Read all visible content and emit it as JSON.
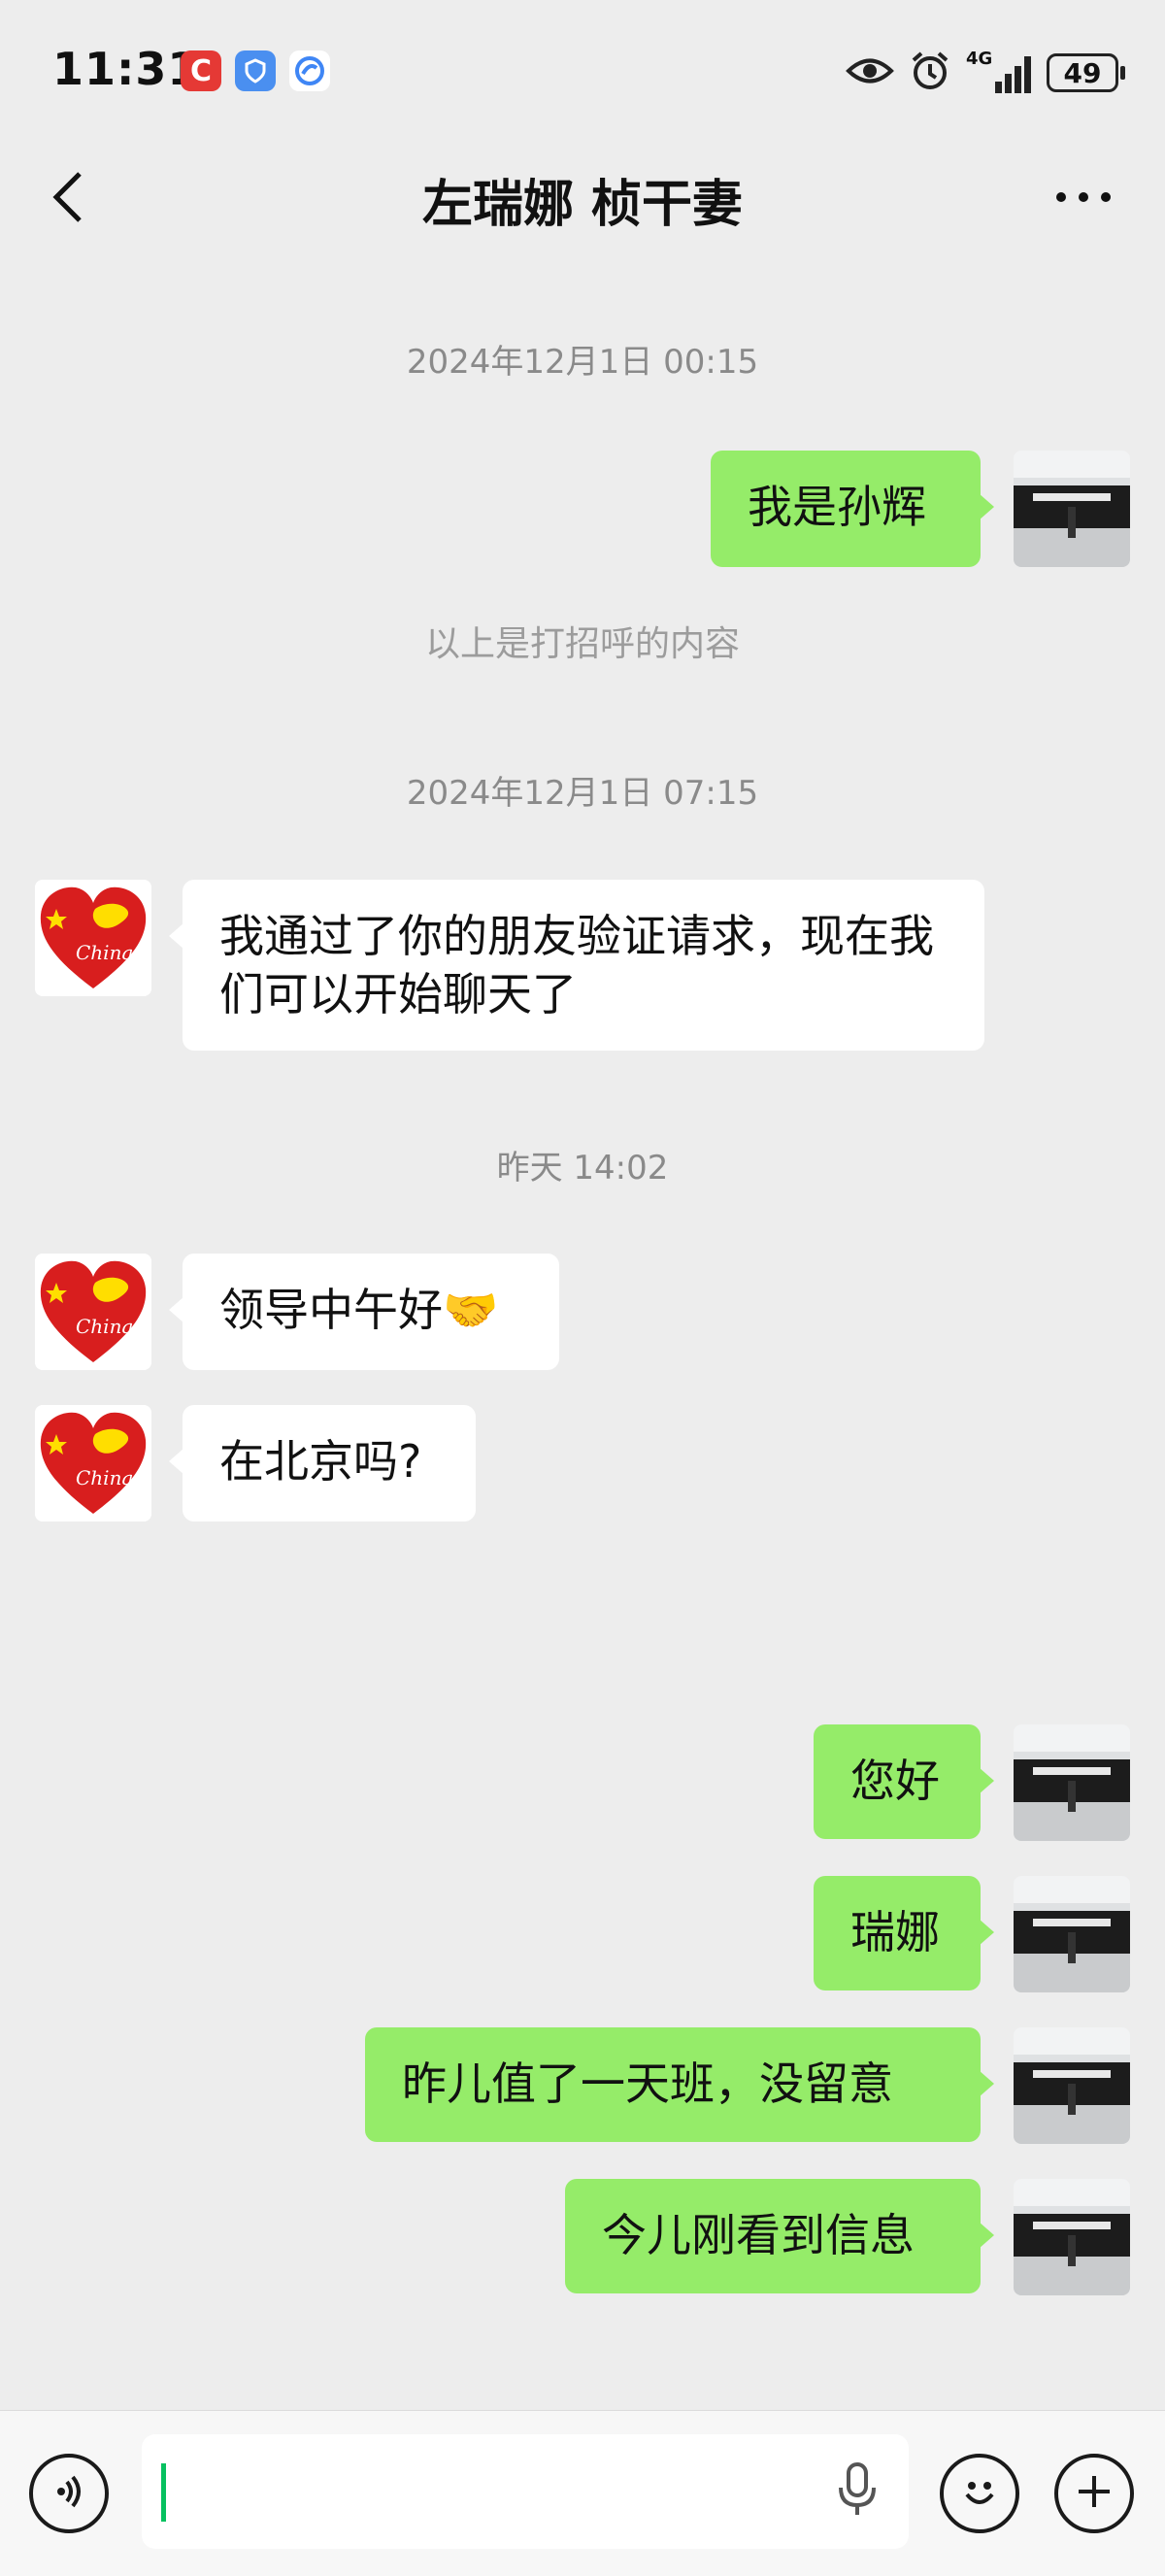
{
  "status_bar": {
    "time": "11:31",
    "network": "4G",
    "battery": "49",
    "icons": [
      "app-c-icon",
      "shield-app-icon",
      "sync-app-icon",
      "eye-icon",
      "alarm-icon",
      "signal-icon",
      "battery-icon"
    ]
  },
  "header": {
    "title": "左瑞娜 桢干妻",
    "back_icon": "chevron-left-icon",
    "more_icon": "more-icon"
  },
  "chat": {
    "timestamps": [
      "2024年12月1日 00:15",
      "2024年12月1日 07:15",
      "昨天 14:02"
    ],
    "system_note": "以上是打招呼的内容",
    "messages": [
      {
        "from": "me",
        "text": "我是孙辉"
      },
      {
        "from": "them",
        "text": "我通过了你的朋友验证请求，现在我们可以开始聊天了"
      },
      {
        "from": "them",
        "text": "领导中午好🤝"
      },
      {
        "from": "them",
        "text": "在北京吗?"
      },
      {
        "from": "me",
        "text": "您好"
      },
      {
        "from": "me",
        "text": "瑞娜"
      },
      {
        "from": "me",
        "text": "昨儿值了一天班，没留意"
      },
      {
        "from": "me",
        "text": "今儿刚看到信息"
      }
    ],
    "contact_avatar_text": "China"
  },
  "input_bar": {
    "voice_icon": "voice-icon",
    "mic_icon": "microphone-icon",
    "emoji_icon": "emoji-icon",
    "plus_icon": "plus-icon",
    "text_value": ""
  },
  "colors": {
    "background": "#ededed",
    "bubble_outgoing": "#95ec69",
    "bubble_incoming": "#ffffff",
    "caret": "#07c160"
  }
}
